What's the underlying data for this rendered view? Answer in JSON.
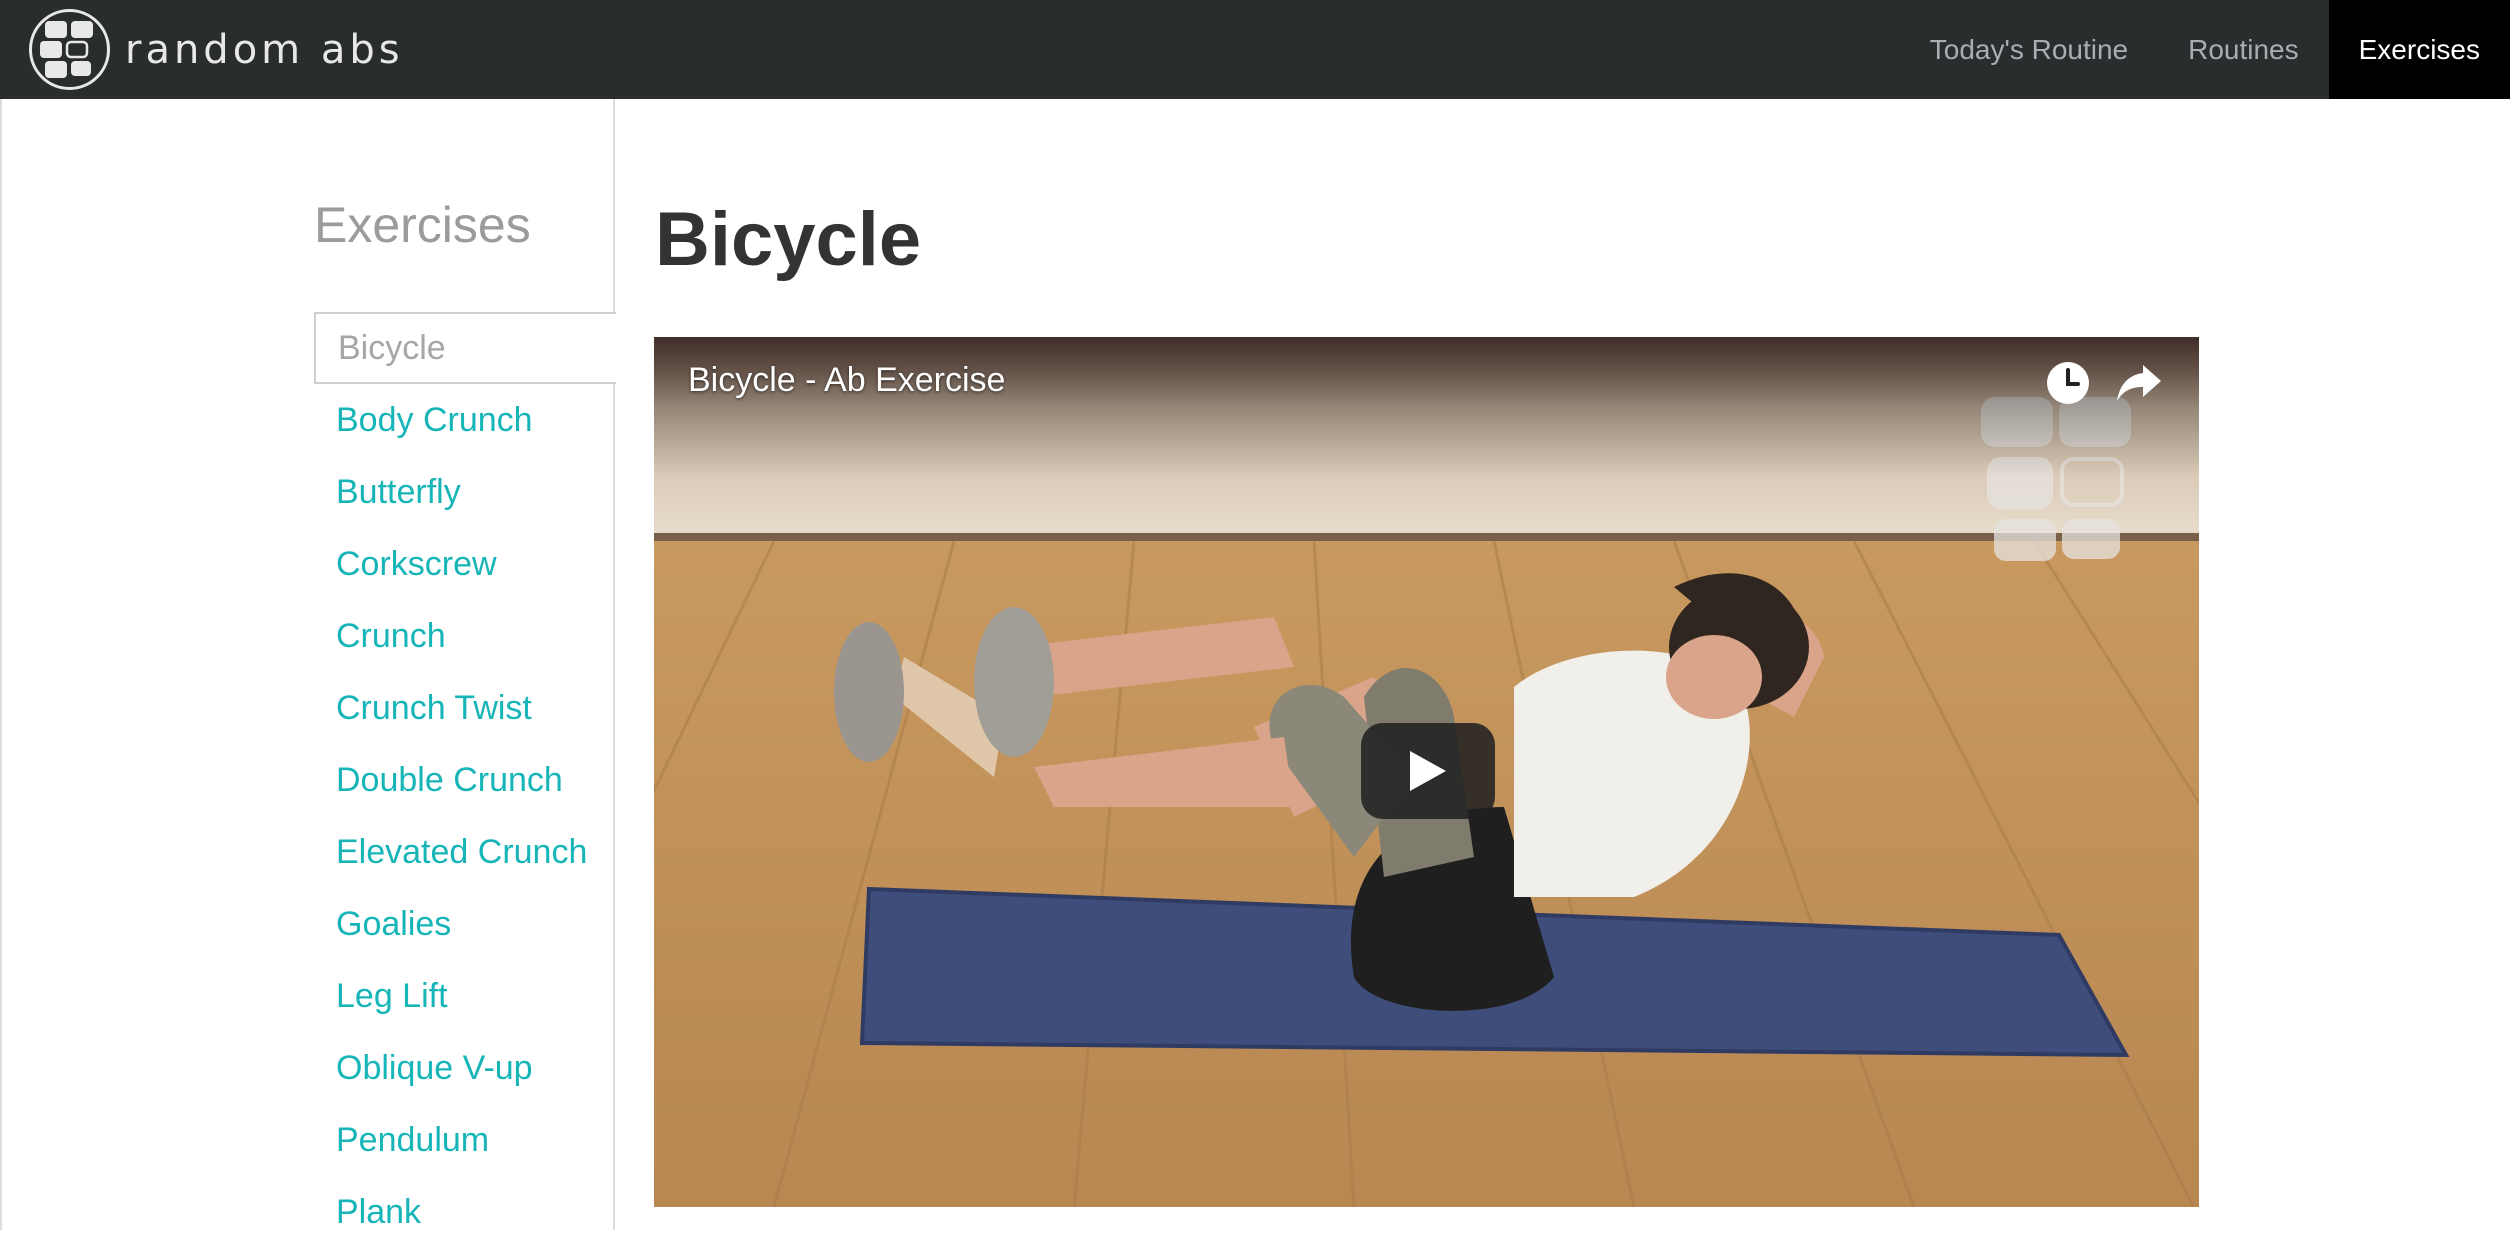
{
  "brand": {
    "name": "random abs",
    "logo_icon": "abs-grid-logo"
  },
  "nav": {
    "items": [
      {
        "label": "Today's Routine",
        "active": false
      },
      {
        "label": "Routines",
        "active": false
      },
      {
        "label": "Exercises",
        "active": true
      }
    ]
  },
  "sidebar": {
    "title": "Exercises",
    "items": [
      {
        "label": "Bicycle",
        "active": true
      },
      {
        "label": "Body Crunch"
      },
      {
        "label": "Butterfly"
      },
      {
        "label": "Corkscrew"
      },
      {
        "label": "Crunch"
      },
      {
        "label": "Crunch Twist"
      },
      {
        "label": "Double Crunch"
      },
      {
        "label": "Elevated Crunch"
      },
      {
        "label": "Goalies"
      },
      {
        "label": "Leg Lift"
      },
      {
        "label": "Oblique V-up"
      },
      {
        "label": "Pendulum"
      },
      {
        "label": "Plank"
      }
    ]
  },
  "main": {
    "title": "Bicycle",
    "video": {
      "title": "Bicycle - Ab Exercise",
      "icons": [
        "clock-icon",
        "share-icon",
        "play-icon"
      ]
    }
  },
  "colors": {
    "navbar": "#2a2d2e",
    "nav_active": "#000000",
    "link": "#17b5b8",
    "muted": "#9b9b9b",
    "title": "#333333"
  }
}
